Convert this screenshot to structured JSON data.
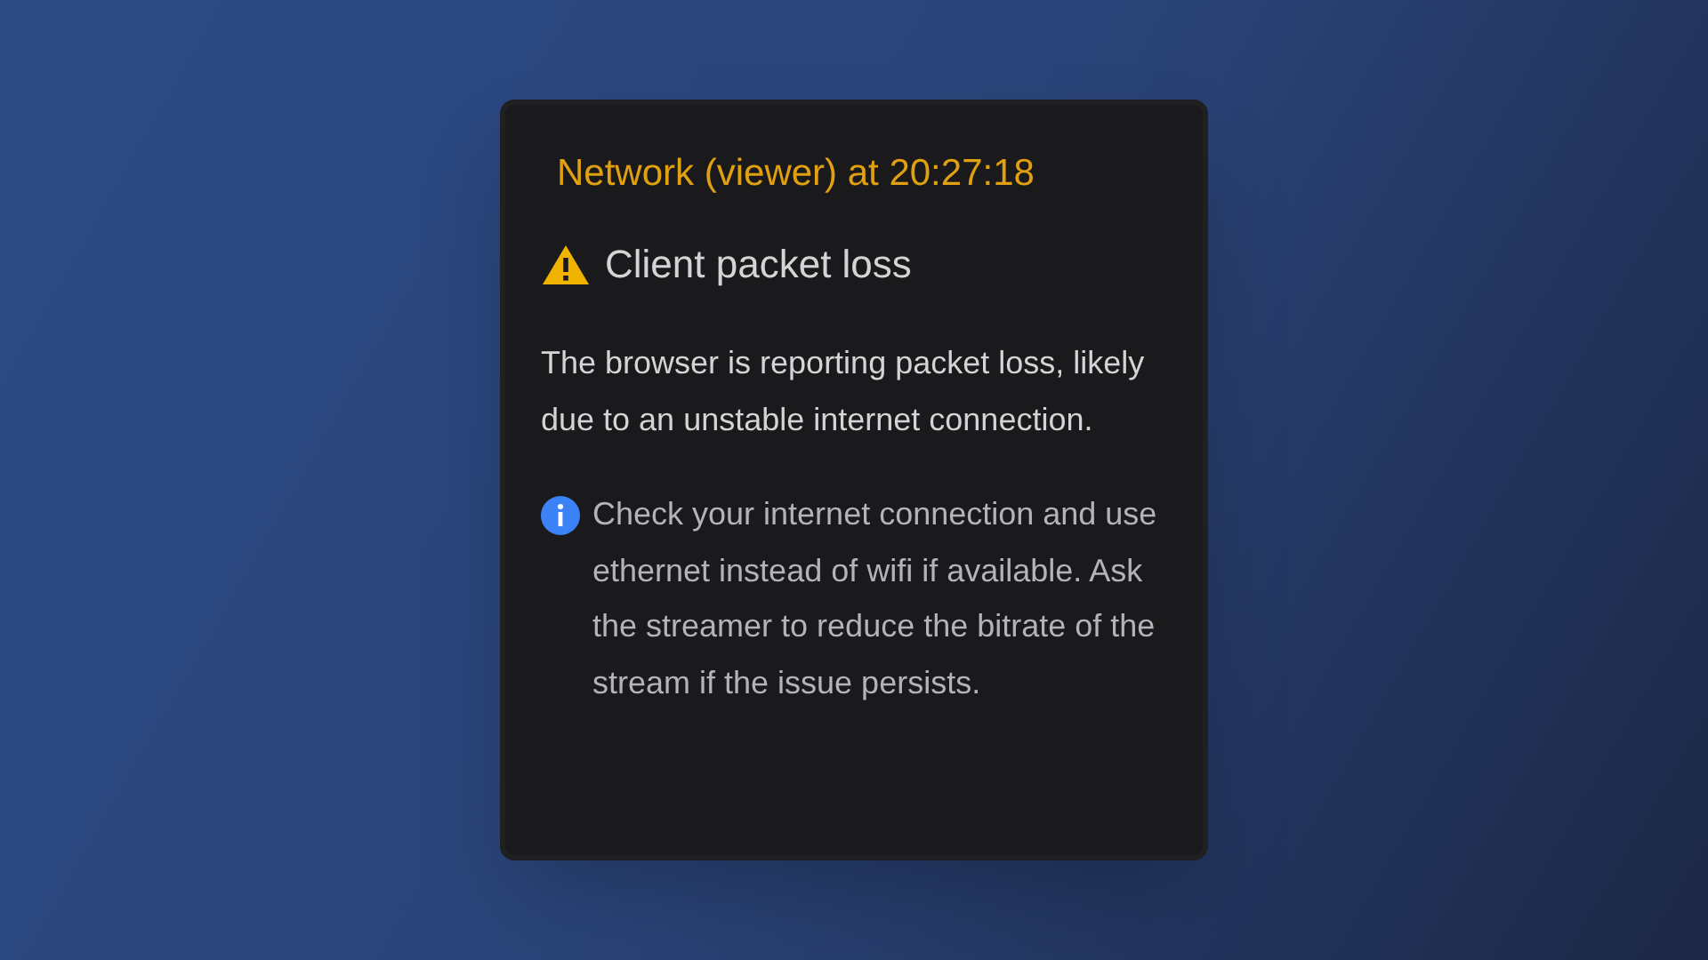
{
  "popup": {
    "title": "Network (viewer) at 20:27:18",
    "alert": {
      "kind": "warning",
      "heading": "Client packet loss"
    },
    "description": "The browser is reporting packet loss, likely due to an unstable internet connection.",
    "tip": {
      "kind": "info",
      "text": "Check your internet connection and use ethernet instead of wifi if available. Ask the streamer to reduce the bitrate of the stream if the issue persists."
    }
  }
}
